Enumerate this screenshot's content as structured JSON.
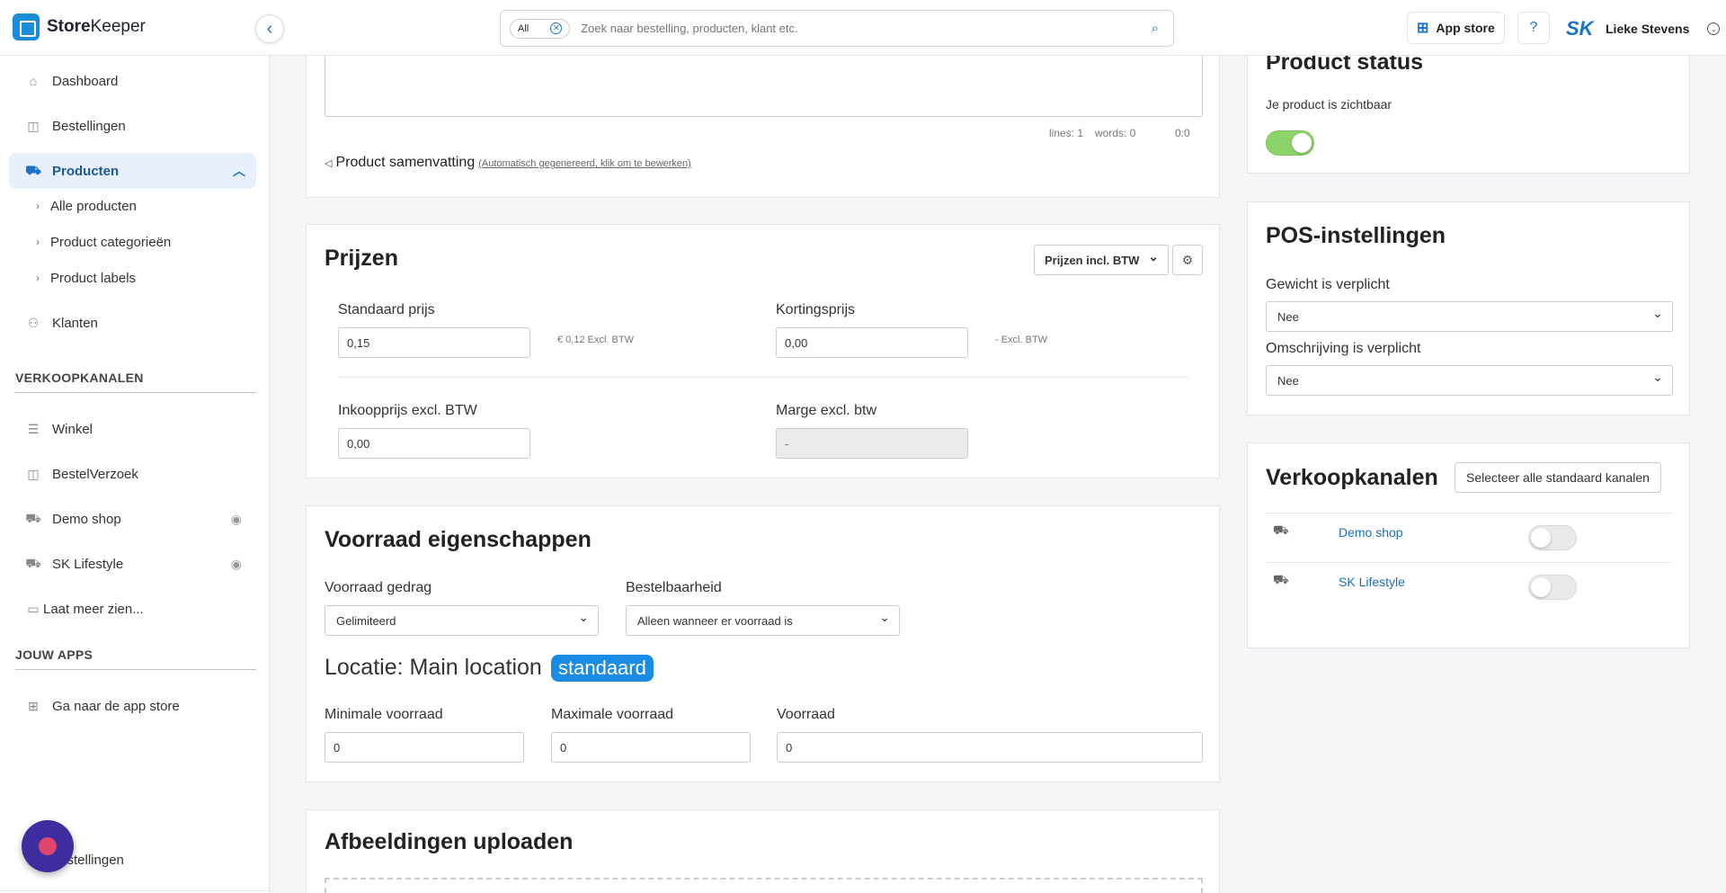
{
  "app": {
    "logo_bold": "Store",
    "logo_light": "Keeper"
  },
  "search": {
    "scope": "All",
    "placeholder": "Zoek naar bestelling, producten, klant etc."
  },
  "header": {
    "appstore_label": "App store",
    "user_name": "Lieke Stevens",
    "avatar_text": "SK"
  },
  "sidebar": {
    "dashboard": "Dashboard",
    "bestellingen": "Bestellingen",
    "producten": "Producten",
    "sub_items": [
      "Alle producten",
      "Product categorieën",
      "Product labels"
    ],
    "klanten": "Klanten",
    "verkoopkanalen_section": "VERKOOPKANALEN",
    "winkel": "Winkel",
    "bestelverzoek": "BestelVerzoek",
    "demo_shop": "Demo shop",
    "sk_lifestyle": "SK Lifestyle",
    "meer": "Laat meer zien...",
    "apps_section": "JOUW APPS",
    "appstore": "Ga naar de app store",
    "instellingen": "Instellingen"
  },
  "editor": {
    "lines": "lines: 1",
    "words": "words: 0",
    "pos": "0:0",
    "summary_title": "Product samenvatting",
    "summary_note": "(Automatisch gegenereerd, klik om te bewerken)"
  },
  "prijzen": {
    "title": "Prijzen",
    "mode_select": "Prijzen incl. BTW",
    "standaard_label": "Standaard prijs",
    "standaard_value": "0,15",
    "standaard_excl": "€ 0,12 Excl. BTW",
    "korting_label": "Kortingsprijs",
    "korting_value": "0,00",
    "korting_excl": "- Excl. BTW",
    "inkoop_label": "Inkoopprijs excl. BTW",
    "inkoop_value": "0,00",
    "marge_label": "Marge excl. btw",
    "marge_value": "-"
  },
  "voorraad": {
    "title": "Voorraad eigenschappen",
    "gedrag_label": "Voorraad gedrag",
    "gedrag_value": "Gelimiteerd",
    "bestelbaar_label": "Bestelbaarheid",
    "bestelbaar_value": "Alleen wanneer er voorraad is",
    "locatie": "Locatie: Main location",
    "locatie_badge": "standaard",
    "min_label": "Minimale voorraad",
    "min_value": "0",
    "max_label": "Maximale voorraad",
    "max_value": "0",
    "stock_label": "Voorraad",
    "stock_value": "0"
  },
  "afbeeldingen": {
    "title": "Afbeeldingen uploaden"
  },
  "product_status": {
    "title": "Product status",
    "text": "Je product is zichtbaar",
    "visible": true
  },
  "pos": {
    "title": "POS-instellingen",
    "gewicht_label": "Gewicht is verplicht",
    "gewicht_value": "Nee",
    "omschrijving_label": "Omschrijving is verplicht",
    "omschrijving_value": "Nee"
  },
  "kanalen": {
    "title": "Verkoopkanalen",
    "select_all": "Selecteer alle standaard kanalen",
    "items": [
      {
        "name": "Demo shop",
        "enabled": false
      },
      {
        "name": "SK Lifestyle",
        "enabled": false
      }
    ]
  }
}
